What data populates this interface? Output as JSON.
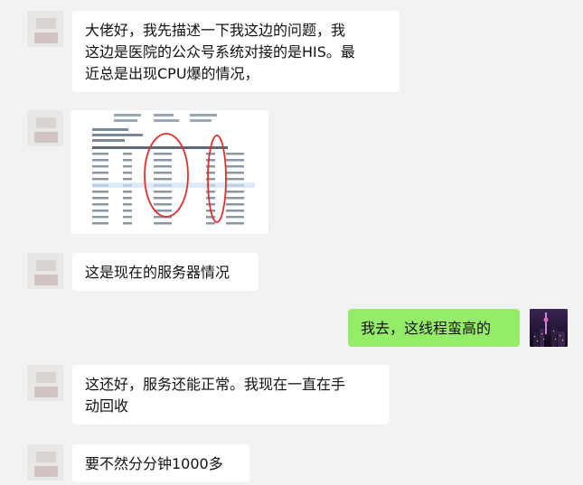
{
  "messages": [
    {
      "sender": "other",
      "text_lines": [
        "大佬好，我先描述一下我这边的问题，我",
        "这边是医院的公众号系统对接的是HIS。最",
        "近总是出现CPU爆的情况，"
      ]
    },
    {
      "sender": "other",
      "type": "image",
      "description": ""
    },
    {
      "sender": "other",
      "text": "这是现在的服务器情况"
    },
    {
      "sender": "self",
      "text": "我去，这线程蛮高的"
    },
    {
      "sender": "other",
      "text_lines": [
        "这还好，服务还能正常。我现在一直在手",
        "动回收"
      ]
    },
    {
      "sender": "other",
      "text": "要不然分分钟1000多"
    }
  ],
  "colors": {
    "background": "#f2f2f2",
    "bubble_other": "#ffffff",
    "bubble_self": "#95ec69",
    "annotation_circle": "#e0302b"
  },
  "icons": {
    "user_avatar": "night-city-photo",
    "other_avatar": "blurred-avatar"
  }
}
